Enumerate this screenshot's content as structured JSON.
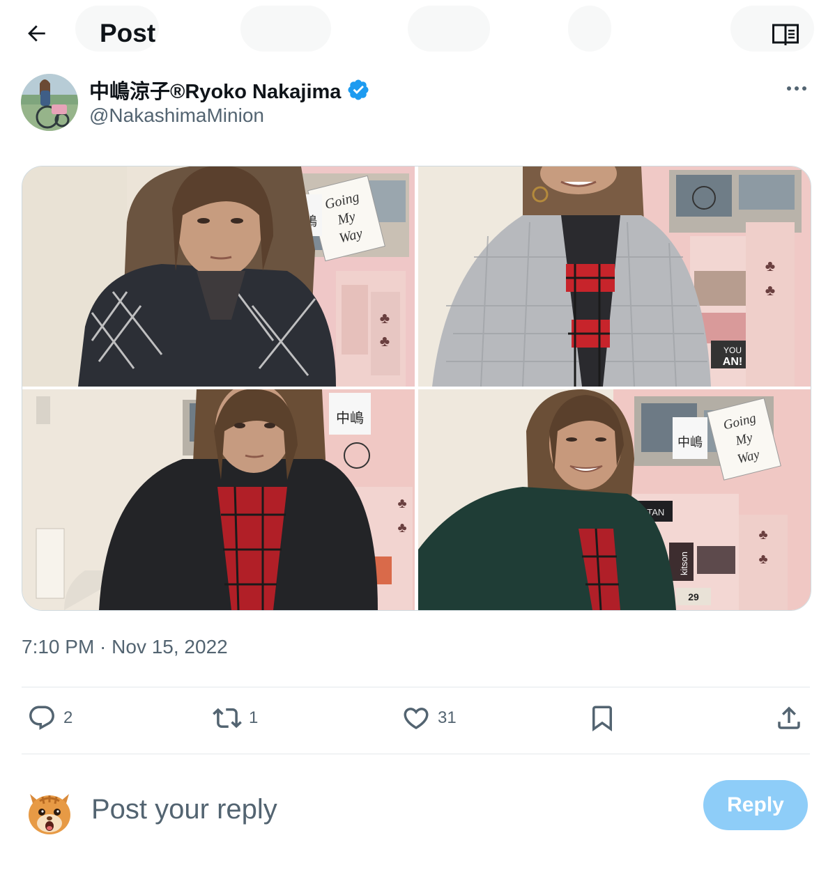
{
  "header": {
    "title": "Post",
    "back_icon": "arrow-left-icon",
    "reader_icon": "open-book-icon"
  },
  "post": {
    "author": {
      "display_name": "中嶋涼子®Ryoko Nakajima",
      "handle": "@NakashimaMinion",
      "verified": true,
      "verified_color": "#1d9bf0"
    },
    "media": {
      "count": 4,
      "photos": [
        {
          "name": "photo-1",
          "description_icon": "photo"
        },
        {
          "name": "photo-2",
          "description_icon": "photo"
        },
        {
          "name": "photo-3",
          "description_icon": "photo"
        },
        {
          "name": "photo-4",
          "description_icon": "photo"
        }
      ],
      "sign_lines": [
        "Going",
        "My",
        "Way"
      ],
      "sign_name": "中嶋",
      "shelf_labels": [
        "TITAN",
        "kitson",
        "YOU",
        "AN!",
        "29"
      ]
    },
    "timestamp": "7:10 PM · Nov 15, 2022",
    "stats": {
      "replies": "2",
      "reposts": "1",
      "likes": "31"
    }
  },
  "reply": {
    "placeholder": "Post your reply",
    "button_label": "Reply",
    "button_color": "#8ecdf8"
  },
  "colors": {
    "text_primary": "#0f1419",
    "text_secondary": "#536471",
    "divider": "#e3e8eb"
  }
}
